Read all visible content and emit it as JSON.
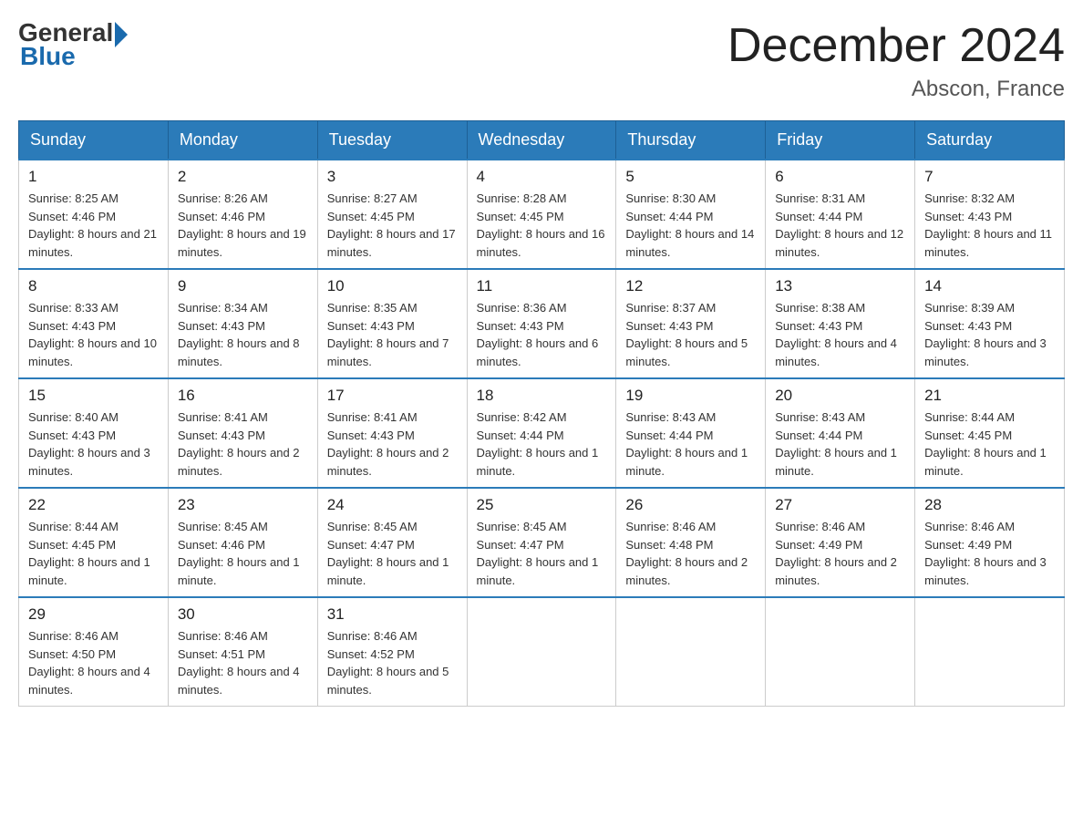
{
  "logo": {
    "general": "General",
    "blue": "Blue"
  },
  "header": {
    "month": "December 2024",
    "location": "Abscon, France"
  },
  "weekdays": [
    "Sunday",
    "Monday",
    "Tuesday",
    "Wednesday",
    "Thursday",
    "Friday",
    "Saturday"
  ],
  "weeks": [
    [
      {
        "day": "1",
        "sunrise": "8:25 AM",
        "sunset": "4:46 PM",
        "daylight": "8 hours and 21 minutes."
      },
      {
        "day": "2",
        "sunrise": "8:26 AM",
        "sunset": "4:46 PM",
        "daylight": "8 hours and 19 minutes."
      },
      {
        "day": "3",
        "sunrise": "8:27 AM",
        "sunset": "4:45 PM",
        "daylight": "8 hours and 17 minutes."
      },
      {
        "day": "4",
        "sunrise": "8:28 AM",
        "sunset": "4:45 PM",
        "daylight": "8 hours and 16 minutes."
      },
      {
        "day": "5",
        "sunrise": "8:30 AM",
        "sunset": "4:44 PM",
        "daylight": "8 hours and 14 minutes."
      },
      {
        "day": "6",
        "sunrise": "8:31 AM",
        "sunset": "4:44 PM",
        "daylight": "8 hours and 12 minutes."
      },
      {
        "day": "7",
        "sunrise": "8:32 AM",
        "sunset": "4:43 PM",
        "daylight": "8 hours and 11 minutes."
      }
    ],
    [
      {
        "day": "8",
        "sunrise": "8:33 AM",
        "sunset": "4:43 PM",
        "daylight": "8 hours and 10 minutes."
      },
      {
        "day": "9",
        "sunrise": "8:34 AM",
        "sunset": "4:43 PM",
        "daylight": "8 hours and 8 minutes."
      },
      {
        "day": "10",
        "sunrise": "8:35 AM",
        "sunset": "4:43 PM",
        "daylight": "8 hours and 7 minutes."
      },
      {
        "day": "11",
        "sunrise": "8:36 AM",
        "sunset": "4:43 PM",
        "daylight": "8 hours and 6 minutes."
      },
      {
        "day": "12",
        "sunrise": "8:37 AM",
        "sunset": "4:43 PM",
        "daylight": "8 hours and 5 minutes."
      },
      {
        "day": "13",
        "sunrise": "8:38 AM",
        "sunset": "4:43 PM",
        "daylight": "8 hours and 4 minutes."
      },
      {
        "day": "14",
        "sunrise": "8:39 AM",
        "sunset": "4:43 PM",
        "daylight": "8 hours and 3 minutes."
      }
    ],
    [
      {
        "day": "15",
        "sunrise": "8:40 AM",
        "sunset": "4:43 PM",
        "daylight": "8 hours and 3 minutes."
      },
      {
        "day": "16",
        "sunrise": "8:41 AM",
        "sunset": "4:43 PM",
        "daylight": "8 hours and 2 minutes."
      },
      {
        "day": "17",
        "sunrise": "8:41 AM",
        "sunset": "4:43 PM",
        "daylight": "8 hours and 2 minutes."
      },
      {
        "day": "18",
        "sunrise": "8:42 AM",
        "sunset": "4:44 PM",
        "daylight": "8 hours and 1 minute."
      },
      {
        "day": "19",
        "sunrise": "8:43 AM",
        "sunset": "4:44 PM",
        "daylight": "8 hours and 1 minute."
      },
      {
        "day": "20",
        "sunrise": "8:43 AM",
        "sunset": "4:44 PM",
        "daylight": "8 hours and 1 minute."
      },
      {
        "day": "21",
        "sunrise": "8:44 AM",
        "sunset": "4:45 PM",
        "daylight": "8 hours and 1 minute."
      }
    ],
    [
      {
        "day": "22",
        "sunrise": "8:44 AM",
        "sunset": "4:45 PM",
        "daylight": "8 hours and 1 minute."
      },
      {
        "day": "23",
        "sunrise": "8:45 AM",
        "sunset": "4:46 PM",
        "daylight": "8 hours and 1 minute."
      },
      {
        "day": "24",
        "sunrise": "8:45 AM",
        "sunset": "4:47 PM",
        "daylight": "8 hours and 1 minute."
      },
      {
        "day": "25",
        "sunrise": "8:45 AM",
        "sunset": "4:47 PM",
        "daylight": "8 hours and 1 minute."
      },
      {
        "day": "26",
        "sunrise": "8:46 AM",
        "sunset": "4:48 PM",
        "daylight": "8 hours and 2 minutes."
      },
      {
        "day": "27",
        "sunrise": "8:46 AM",
        "sunset": "4:49 PM",
        "daylight": "8 hours and 2 minutes."
      },
      {
        "day": "28",
        "sunrise": "8:46 AM",
        "sunset": "4:49 PM",
        "daylight": "8 hours and 3 minutes."
      }
    ],
    [
      {
        "day": "29",
        "sunrise": "8:46 AM",
        "sunset": "4:50 PM",
        "daylight": "8 hours and 4 minutes."
      },
      {
        "day": "30",
        "sunrise": "8:46 AM",
        "sunset": "4:51 PM",
        "daylight": "8 hours and 4 minutes."
      },
      {
        "day": "31",
        "sunrise": "8:46 AM",
        "sunset": "4:52 PM",
        "daylight": "8 hours and 5 minutes."
      },
      null,
      null,
      null,
      null
    ]
  ]
}
